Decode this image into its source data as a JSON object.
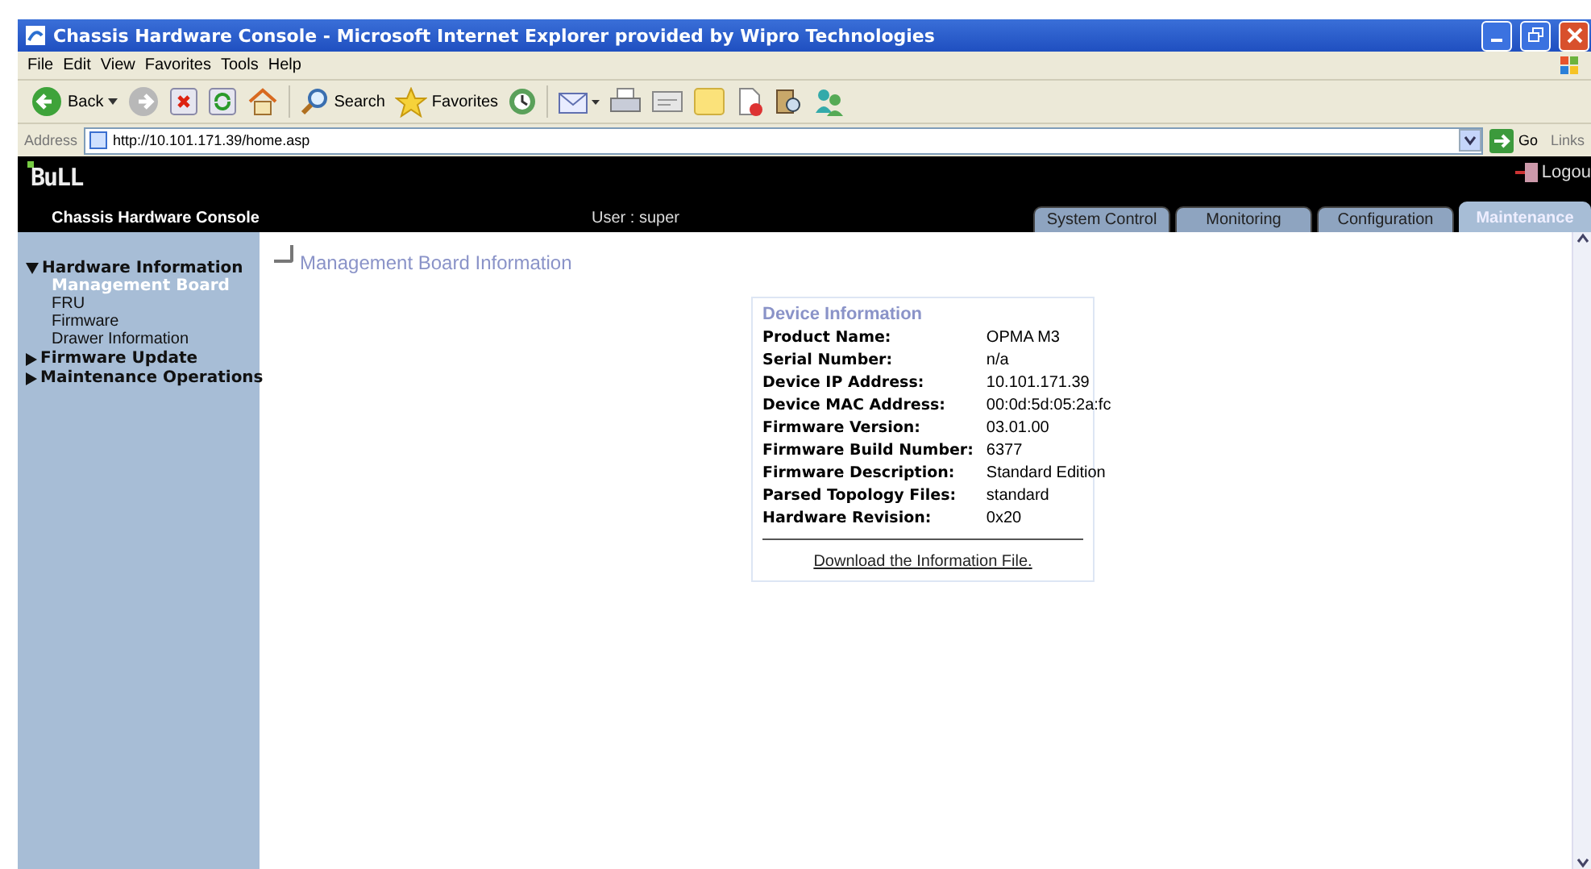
{
  "window": {
    "title": "Chassis Hardware Console - Microsoft Internet Explorer provided by Wipro Technologies"
  },
  "menu": [
    "File",
    "Edit",
    "View",
    "Favorites",
    "Tools",
    "Help"
  ],
  "toolbar": {
    "back": "Back",
    "search": "Search",
    "favorites": "Favorites"
  },
  "address_bar": {
    "label": "Address",
    "url": "http://10.101.171.39/home.asp",
    "go": "Go",
    "links": "Links"
  },
  "header": {
    "logo": "BuLL",
    "title": "Chassis Hardware Console",
    "user": "User : super",
    "logout": "Logou"
  },
  "tabs": [
    {
      "label": "System Control",
      "selected": false
    },
    {
      "label": "Monitoring",
      "selected": false
    },
    {
      "label": "Configuration",
      "selected": false
    },
    {
      "label": "Maintenance",
      "selected": true
    }
  ],
  "sidebar": {
    "items": [
      {
        "label": "Hardware Information",
        "expanded": true,
        "children": [
          {
            "label": "Management Board",
            "selected": true
          },
          {
            "label": "FRU",
            "selected": false
          },
          {
            "label": "Firmware",
            "selected": false
          },
          {
            "label": "Drawer Information",
            "selected": false
          }
        ]
      },
      {
        "label": "Firmware Update",
        "expanded": false
      },
      {
        "label": "Maintenance Operations",
        "expanded": false
      }
    ]
  },
  "page": {
    "heading": "Management Board Information",
    "card": {
      "legend": "Device Information",
      "rows": [
        {
          "label": "Product Name:",
          "value": "OPMA M3"
        },
        {
          "label": "Serial Number:",
          "value": "n/a"
        },
        {
          "label": "Device IP Address:",
          "value": "10.101.171.39"
        },
        {
          "label": "Device MAC Address:",
          "value": "00:0d:5d:05:2a:fc"
        },
        {
          "label": "Firmware Version:",
          "value": "03.01.00"
        },
        {
          "label": "Firmware Build Number:",
          "value": "6377"
        },
        {
          "label": "Firmware Description:",
          "value": "Standard Edition"
        },
        {
          "label": "Parsed Topology Files:",
          "value": "standard"
        },
        {
          "label": "Hardware Revision:",
          "value": "0x20"
        }
      ],
      "link": "Download the Information File."
    }
  }
}
